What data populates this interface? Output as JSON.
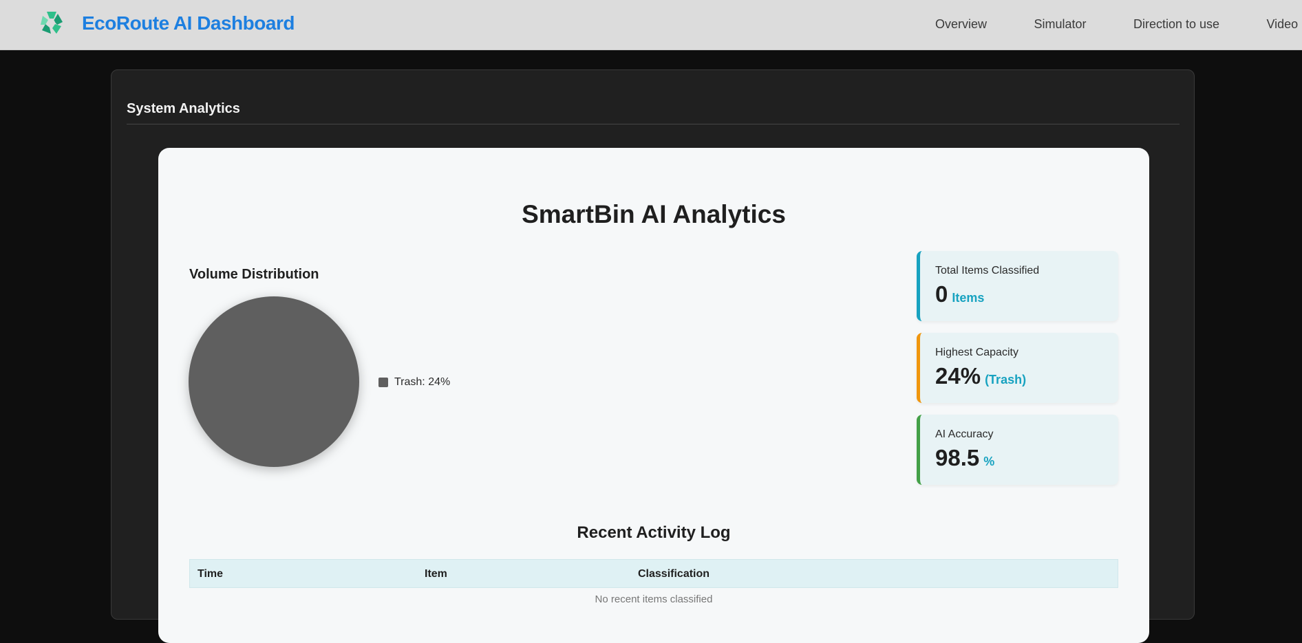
{
  "header": {
    "brand": "EcoRoute AI Dashboard",
    "nav": [
      "Overview",
      "Simulator",
      "Direction to use",
      "Video I"
    ]
  },
  "panel": {
    "title": "System Analytics"
  },
  "card": {
    "title": "SmartBin AI Analytics",
    "volume_title": "Volume Distribution",
    "legend": "Trash: 24%",
    "stats": [
      {
        "label": "Total Items Classified",
        "value": "0",
        "unit": "Items"
      },
      {
        "label": "Highest Capacity",
        "value": "24%",
        "unit": "(Trash)"
      },
      {
        "label": "AI Accuracy",
        "value": "98.5",
        "unit": "%"
      }
    ],
    "log_title": "Recent Activity Log",
    "log_headers": [
      "Time",
      "Item",
      "Classification"
    ],
    "log_empty": "No recent items classified"
  },
  "chart_data": {
    "type": "pie",
    "categories": [
      "Trash"
    ],
    "values": [
      24
    ],
    "title": "Volume Distribution"
  },
  "colors": {
    "brand": "#1d7fe0",
    "trash": "#5f5f5f",
    "accent_cyan": "#17a2c0",
    "accent_orange": "#f0960e",
    "accent_green": "#43a047"
  }
}
